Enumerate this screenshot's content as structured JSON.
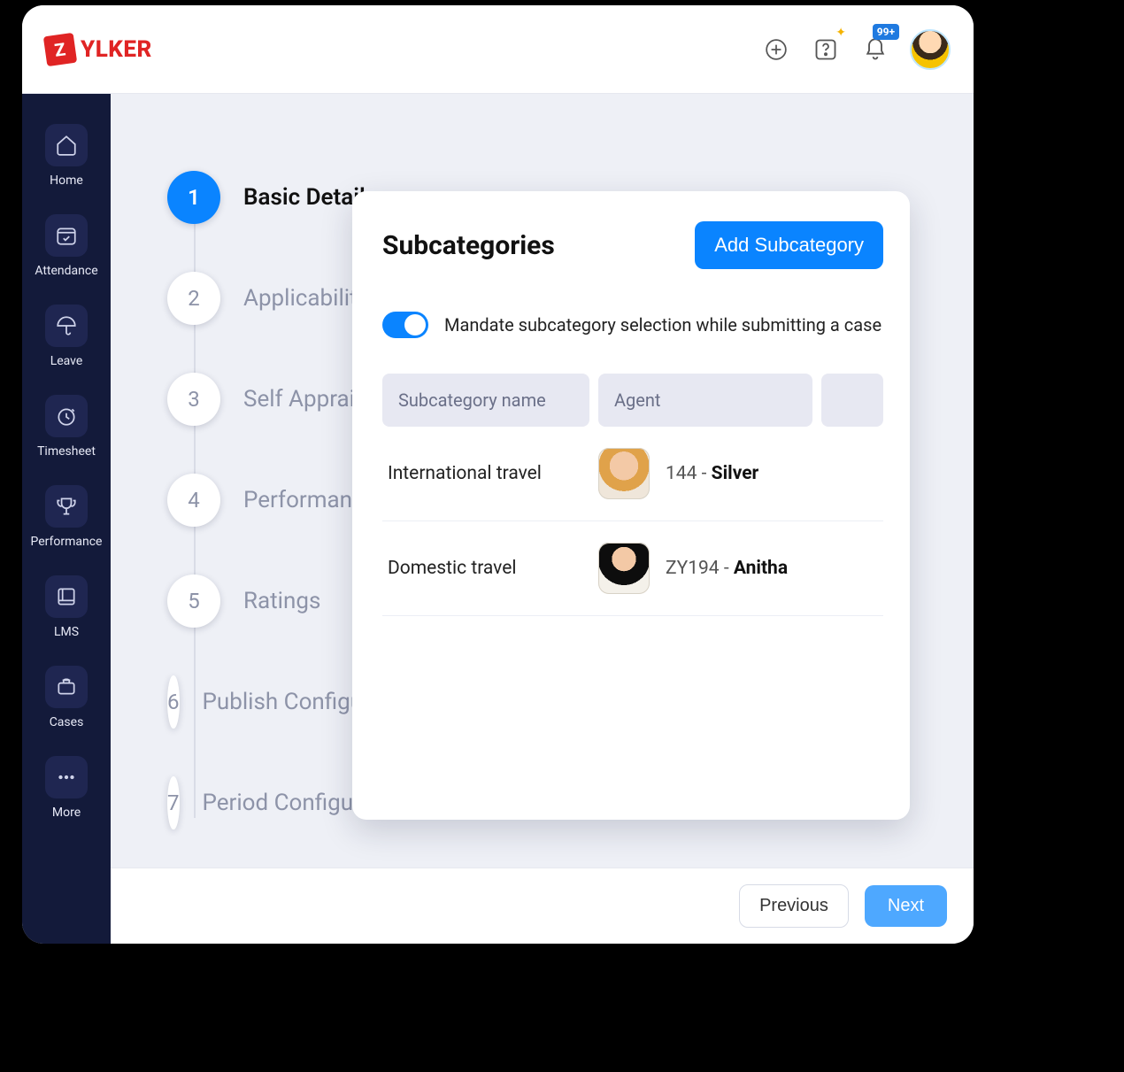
{
  "brand": {
    "badge": "Z",
    "name": "YLKER"
  },
  "header": {
    "notification_badge": "99+"
  },
  "sidebar": {
    "items": [
      {
        "label": "Home",
        "icon": "home-icon"
      },
      {
        "label": "Attendance",
        "icon": "calendar-check-icon"
      },
      {
        "label": "Leave",
        "icon": "umbrella-icon"
      },
      {
        "label": "Timesheet",
        "icon": "clock-icon"
      },
      {
        "label": "Performance",
        "icon": "trophy-icon"
      },
      {
        "label": "LMS",
        "icon": "book-icon"
      },
      {
        "label": "Cases",
        "icon": "briefcase-icon"
      },
      {
        "label": "More",
        "icon": "dots-icon"
      }
    ]
  },
  "stepper": {
    "steps": [
      {
        "num": "1",
        "label": "Basic Details",
        "active": true
      },
      {
        "num": "2",
        "label": "Applicability"
      },
      {
        "num": "3",
        "label": "Self Appraisal"
      },
      {
        "num": "4",
        "label": "Performance"
      },
      {
        "num": "5",
        "label": "Ratings"
      },
      {
        "num": "6",
        "label": "Publish Configuration"
      },
      {
        "num": "7",
        "label": "Period Configuration"
      }
    ]
  },
  "panel": {
    "title": "Subcategories",
    "add_button": "Add Subcategory",
    "toggle_label": "Mandate subcategory selection while submitting a case",
    "columns": {
      "c1": "Subcategory name",
      "c2": "Agent"
    },
    "rows": [
      {
        "name": "International travel",
        "agent_id": "144",
        "agent_name": "Silver"
      },
      {
        "name": "Domestic travel",
        "agent_id": "ZY194",
        "agent_name": "Anitha"
      }
    ]
  },
  "footer": {
    "prev": "Previous",
    "next": "Next"
  }
}
